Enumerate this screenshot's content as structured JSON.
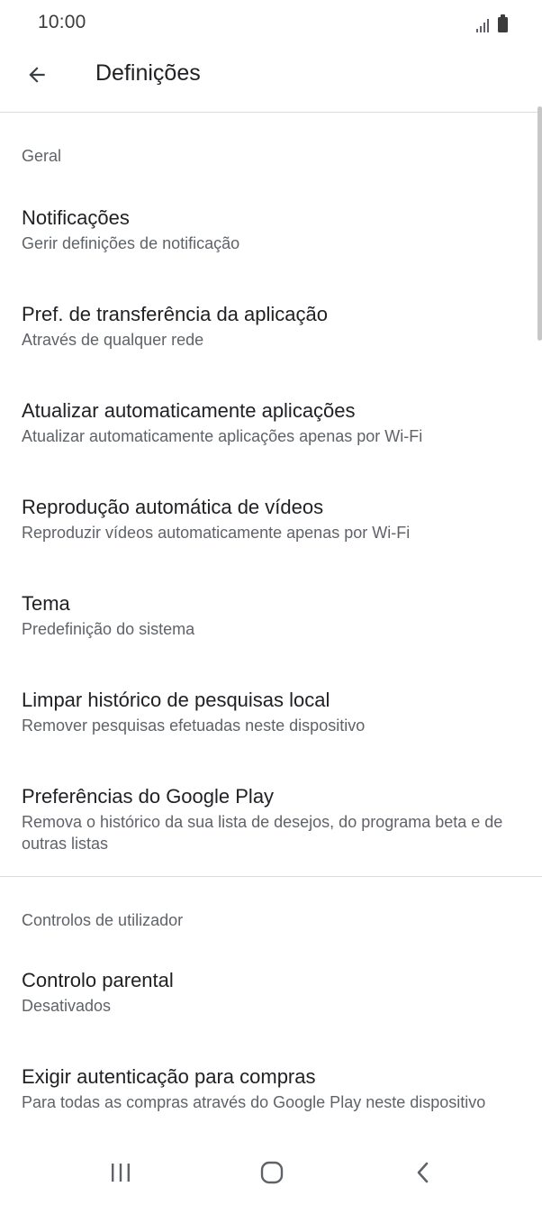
{
  "status_bar": {
    "time": "10:00",
    "icons": [
      "signal-icon",
      "battery-icon"
    ]
  },
  "app_bar": {
    "back_icon": "arrow-back-icon",
    "title": "Definições"
  },
  "sections": [
    {
      "header": "Geral",
      "items": [
        {
          "title": "Notificações",
          "subtitle": "Gerir definições de notificação"
        },
        {
          "title": "Pref. de transferência da aplicação",
          "subtitle": "Através de qualquer rede"
        },
        {
          "title": "Atualizar automaticamente aplicações",
          "subtitle": "Atualizar automaticamente aplicações apenas por Wi-Fi"
        },
        {
          "title": "Reprodução automática de vídeos",
          "subtitle": "Reproduzir vídeos automaticamente apenas por Wi-Fi"
        },
        {
          "title": "Tema",
          "subtitle": "Predefinição do sistema"
        },
        {
          "title": "Limpar histórico de pesquisas local",
          "subtitle": "Remover pesquisas efetuadas neste dispositivo"
        },
        {
          "title": "Preferências do Google Play",
          "subtitle": "Remova o histórico da sua lista de desejos, do programa beta e de outras listas"
        }
      ]
    },
    {
      "header": "Controlos de utilizador",
      "items": [
        {
          "title": "Controlo parental",
          "subtitle": "Desativados"
        },
        {
          "title": "Exigir autenticação para compras",
          "subtitle": "Para todas as compras através do Google Play neste dispositivo"
        }
      ]
    }
  ],
  "nav_bar": {
    "buttons": [
      "recents-icon",
      "home-icon",
      "back-icon"
    ]
  },
  "colors": {
    "text_primary": "#202124",
    "text_secondary": "#5f6368",
    "divider": "#dadce0"
  }
}
